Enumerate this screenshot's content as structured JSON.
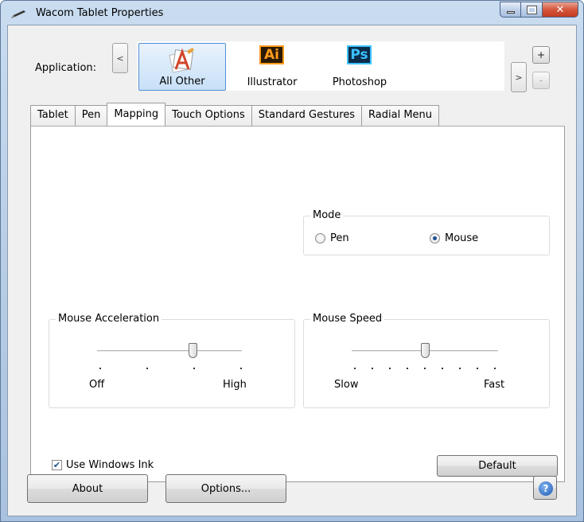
{
  "window": {
    "title": "Wacom Tablet Properties"
  },
  "application_bar": {
    "label": "Application:",
    "prev": "<",
    "next": ">",
    "add": "+",
    "remove": "-",
    "apps": [
      {
        "label": "All Other",
        "icon": "all-other-app-icon",
        "selected": true
      },
      {
        "label": "Illustrator",
        "icon": "illustrator-icon",
        "icon_text": "Ai"
      },
      {
        "label": "Photoshop",
        "icon": "photoshop-icon",
        "icon_text": "Ps"
      }
    ]
  },
  "tabs": [
    {
      "label": "Tablet"
    },
    {
      "label": "Pen"
    },
    {
      "label": "Mapping",
      "active": true
    },
    {
      "label": "Touch Options"
    },
    {
      "label": "Standard Gestures"
    },
    {
      "label": "Radial Menu"
    }
  ],
  "mode": {
    "title": "Mode",
    "options": [
      "Pen",
      "Mouse"
    ],
    "selected": "Mouse"
  },
  "mouse_acceleration": {
    "title": "Mouse Acceleration",
    "min_label": "Off",
    "max_label": "High",
    "level": 0.667
  },
  "mouse_speed": {
    "title": "Mouse Speed",
    "min_label": "Slow",
    "max_label": "Fast",
    "level": 0.5
  },
  "use_windows_ink": {
    "label": "Use Windows Ink",
    "checked": true
  },
  "buttons": {
    "default": "Default",
    "about": "About",
    "options": "Options..."
  }
}
